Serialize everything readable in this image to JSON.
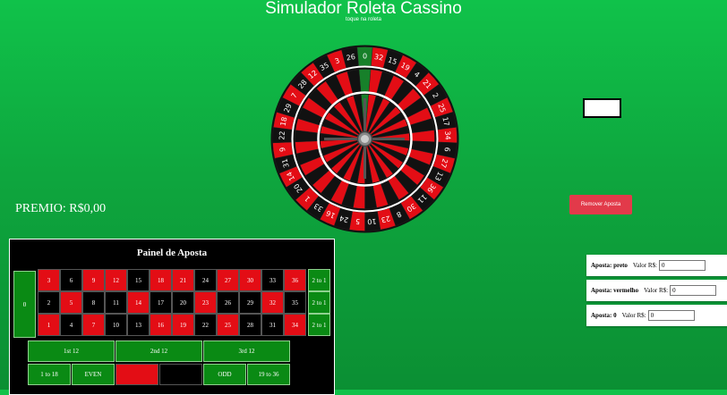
{
  "header": {
    "title": "Simulador Roleta Cassino",
    "subtitle": "toque na roleta"
  },
  "wheel": {
    "order": [
      0,
      32,
      15,
      19,
      4,
      21,
      2,
      25,
      17,
      34,
      6,
      27,
      13,
      36,
      11,
      30,
      8,
      23,
      10,
      5,
      24,
      16,
      33,
      1,
      20,
      14,
      31,
      9,
      22,
      18,
      29,
      7,
      28,
      12,
      35,
      3,
      26
    ],
    "red_numbers": [
      1,
      3,
      5,
      7,
      9,
      12,
      14,
      16,
      18,
      19,
      21,
      23,
      25,
      27,
      30,
      32,
      34,
      36
    ],
    "colors": {
      "red": "#e30d15",
      "black": "#111111",
      "green": "#17802a"
    }
  },
  "premio": {
    "label": "PREMIO: R$0,00"
  },
  "remove_button": {
    "label": "Remover Aposta"
  },
  "bets": [
    {
      "label": "Aposta: preto",
      "value_label": "Valor R$:",
      "value": "0"
    },
    {
      "label": "Aposta: vermelho",
      "value_label": "Valor R$:",
      "value": "0"
    },
    {
      "label": "Aposta: 0",
      "value_label": "Valor R$:",
      "value": "0"
    }
  ],
  "board": {
    "title": "Painel de Aposta",
    "zero": "0",
    "rows": [
      [
        "3",
        "6",
        "9",
        "12",
        "15",
        "18",
        "21",
        "24",
        "27",
        "30",
        "33",
        "36"
      ],
      [
        "2",
        "5",
        "8",
        "11",
        "14",
        "17",
        "20",
        "23",
        "26",
        "29",
        "32",
        "35"
      ],
      [
        "1",
        "4",
        "7",
        "10",
        "13",
        "16",
        "19",
        "22",
        "25",
        "28",
        "31",
        "34"
      ]
    ],
    "columns": [
      "2 to 1",
      "2 to 1",
      "2 to 1"
    ],
    "dozens": [
      "1st 12",
      "2nd 12",
      "3rd 12"
    ],
    "outside": [
      "1 to 18",
      "EVEN",
      "",
      "",
      "ODD",
      "19 to 36"
    ]
  }
}
